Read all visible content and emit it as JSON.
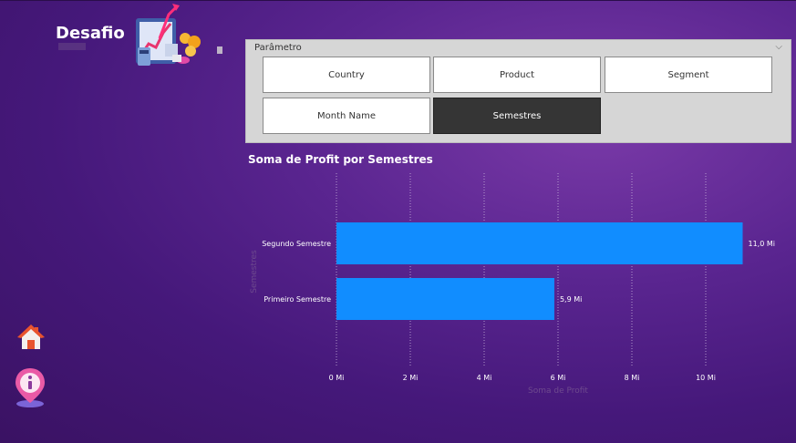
{
  "header": {
    "title": "Desafio"
  },
  "parameter": {
    "title": "Parâmetro",
    "options": [
      {
        "label": "Country",
        "selected": false
      },
      {
        "label": "Product",
        "selected": false
      },
      {
        "label": "Segment",
        "selected": false
      },
      {
        "label": "Month Name",
        "selected": false
      },
      {
        "label": "Semestres",
        "selected": true
      }
    ]
  },
  "chart": {
    "title": "Soma de Profit por Semestres"
  },
  "chart_data": {
    "type": "bar",
    "orientation": "horizontal",
    "title": "Soma de Profit por Semestres",
    "categories": [
      "Segundo Semestre",
      "Primeiro Semestre"
    ],
    "values": [
      11.0,
      5.9
    ],
    "data_labels": [
      "11,0 Mi",
      "5,9 Mi"
    ],
    "xlabel": "Soma de Profit",
    "ylabel": "Semestres",
    "xlim": [
      0,
      11.5
    ],
    "xticks": [
      0,
      2,
      4,
      6,
      8,
      10
    ],
    "xtick_labels": [
      "0 Mi",
      "2 Mi",
      "4 Mi",
      "6 Mi",
      "8 Mi",
      "10 Mi"
    ],
    "bar_color": "#118dff",
    "grid": "vertical dotted"
  },
  "colors": {
    "bar": "#118dff",
    "selected_tile": "#353535"
  },
  "nav": {
    "icons": [
      "home-icon",
      "info-location-icon"
    ]
  }
}
